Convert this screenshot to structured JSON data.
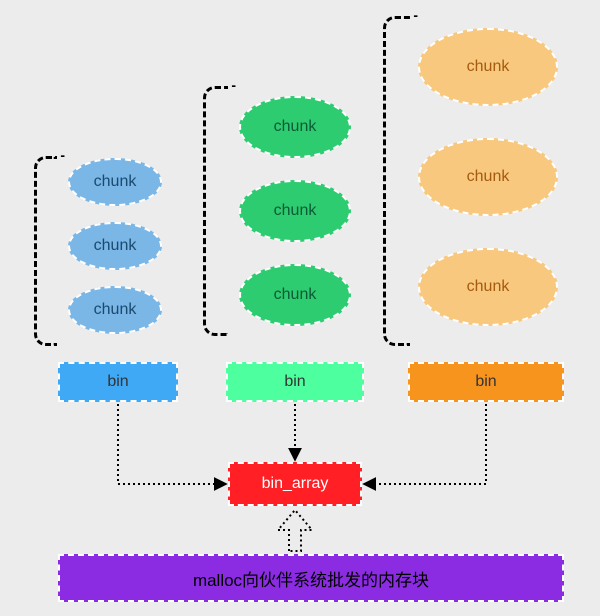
{
  "cols": {
    "blue": {
      "chunks": [
        "chunk",
        "chunk",
        "chunk"
      ],
      "bin": "bin"
    },
    "green": {
      "chunks": [
        "chunk",
        "chunk",
        "chunk"
      ],
      "bin": "bin"
    },
    "orange": {
      "chunks": [
        "chunk",
        "chunk",
        "chunk"
      ],
      "bin": "bin"
    }
  },
  "bin_array": "bin_array",
  "malloc_text": "malloc向伙伴系统批发的内存块"
}
